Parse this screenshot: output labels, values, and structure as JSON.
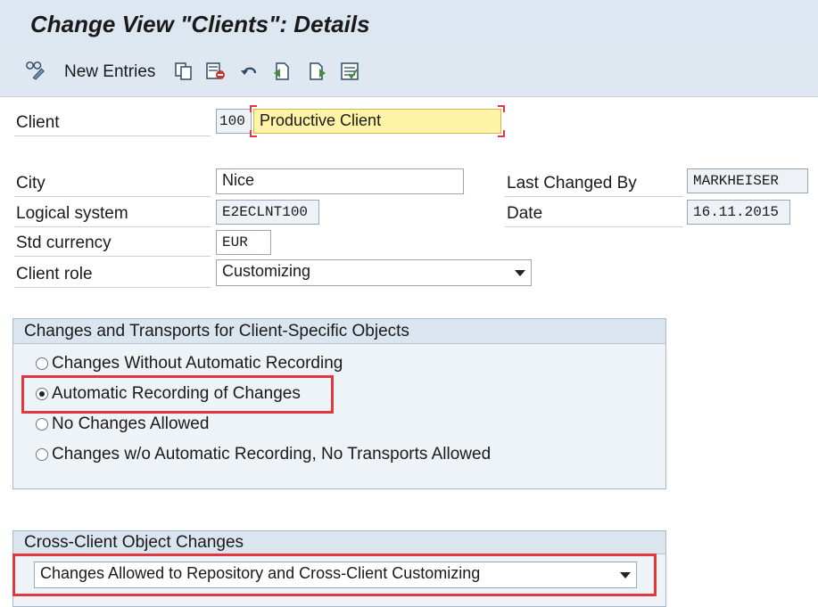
{
  "window": {
    "title": "Change View \"Clients\": Details"
  },
  "toolbar": {
    "new_entries_label": "New Entries",
    "icons": [
      "glasses-pencil-icon",
      "copy-icon",
      "delete-icon",
      "undo-icon",
      "previous-entry-icon",
      "next-entry-icon",
      "select-all-icon"
    ]
  },
  "client": {
    "label": "Client",
    "number": "100",
    "name": "Productive Client"
  },
  "city": {
    "label": "City",
    "value": "Nice"
  },
  "logical_system": {
    "label": "Logical system",
    "value": "E2ECLNT100"
  },
  "std_currency": {
    "label": "Std currency",
    "value": "EUR"
  },
  "client_role": {
    "label": "Client role",
    "value": "Customizing"
  },
  "last_changed_by": {
    "label": "Last Changed By",
    "value": "MARKHEISER"
  },
  "date": {
    "label": "Date",
    "value": "16.11.2015"
  },
  "changes_group": {
    "title": "Changes and Transports for Client-Specific Objects",
    "options": [
      {
        "label": "Changes Without Automatic Recording",
        "selected": false
      },
      {
        "label": "Automatic Recording of Changes",
        "selected": true
      },
      {
        "label": "No Changes Allowed",
        "selected": false
      },
      {
        "label": "Changes w/o Automatic Recording, No Transports Allowed",
        "selected": false
      }
    ]
  },
  "cross_client_group": {
    "title": "Cross-Client Object Changes",
    "value": "Changes Allowed to Repository and Cross-Client Customizing"
  },
  "colors": {
    "highlight_red": "#e0383e",
    "header_blue": "#dde7f1",
    "required_yellow": "#fff3a6"
  }
}
